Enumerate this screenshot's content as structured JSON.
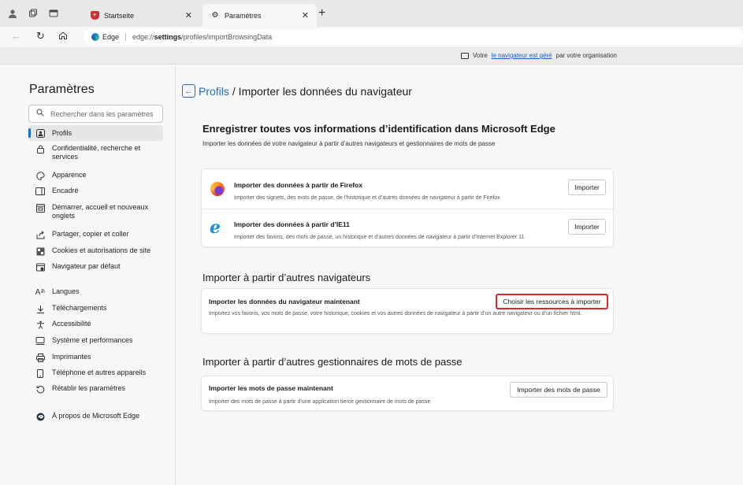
{
  "tabs": {
    "inactive": {
      "label": "Startseite"
    },
    "active": {
      "label": "Paramètres"
    }
  },
  "address": {
    "chip": "Edge",
    "url_prefix": "edge://",
    "url_host": "settings",
    "url_path": "/profiles/importBrowsingData"
  },
  "managed": {
    "before": "Votre",
    "link": "le navigateur est géré",
    "after": "par votre organisation"
  },
  "sidebar": {
    "title": "Paramètres",
    "search_placeholder": "Rechercher dans les paramètres",
    "items": [
      {
        "label": "Profils",
        "icon": "profile-icon"
      },
      {
        "label": "Confidentialité, recherche et services",
        "icon": "lock-icon"
      },
      {
        "label": "Apparence",
        "icon": "palette-icon"
      },
      {
        "label": "Encadré",
        "icon": "sidebar-icon"
      },
      {
        "label": "Démarrer, accueil et nouveaux onglets",
        "icon": "home-tabs-icon"
      },
      {
        "label": "Partager, copier et coller",
        "icon": "share-icon"
      },
      {
        "label": "Cookies et autorisations de site",
        "icon": "cookie-icon"
      },
      {
        "label": "Navigateur par défaut",
        "icon": "browser-icon"
      },
      {
        "label": "Langues",
        "icon": "language-icon"
      },
      {
        "label": "Téléchargements",
        "icon": "download-icon"
      },
      {
        "label": "Accessibilité",
        "icon": "accessibility-icon"
      },
      {
        "label": "Système et performances",
        "icon": "system-icon"
      },
      {
        "label": "Imprimantes",
        "icon": "printer-icon"
      },
      {
        "label": "Téléphone et autres appareils",
        "icon": "phone-icon"
      },
      {
        "label": "Rétablir les paramètres",
        "icon": "reset-icon"
      },
      {
        "label": "À propos de Microsoft Edge",
        "icon": "edge-icon"
      }
    ]
  },
  "main": {
    "breadcrumb_link": "Profils",
    "breadcrumb_rest": "/ Importer les données du navigateur",
    "section1": {
      "title": "Enregistrer toutes vos informations d’identification dans Microsoft Edge",
      "subtitle": "Importer les données de votre navigateur à partir d’autres navigateurs et gestionnaires de mots de passe",
      "firefox": {
        "title": "Importer des données à partir de Firefox",
        "desc": "Importer des signets, des mots de passe, de l’historique et d’autres données de navigateur à partir de Firefox",
        "button": "Importer"
      },
      "ie": {
        "title": "Importer des données à partir d’IE11",
        "desc": "Importer des favoris, des mots de passe, un historique et d’autres données de navigateur à partir d’Internet Explorer 11",
        "button": "Importer"
      }
    },
    "section2": {
      "title": "Importer à partir d’autres navigateurs",
      "row_title": "Importer les données du navigateur maintenant",
      "row_desc": "Importez vos favoris, vos mots de passe, votre historique, cookies et vos autres données de navigateur à partir d’un autre navigateur ou d’un fichier html.",
      "button": "Choisir les ressources à importer"
    },
    "section3": {
      "title": "Importer à partir d’autres gestionnaires de mots de passe",
      "row_title": "Importer les mots de passe maintenant",
      "row_desc": "Importer des mots de passe à partir d’une application tierce gestionnaire de mots de passe",
      "button": "Importer des mots de passe"
    }
  },
  "colors": {
    "accent": "#1a6fc4",
    "highlight_border": "#d42b2b"
  }
}
